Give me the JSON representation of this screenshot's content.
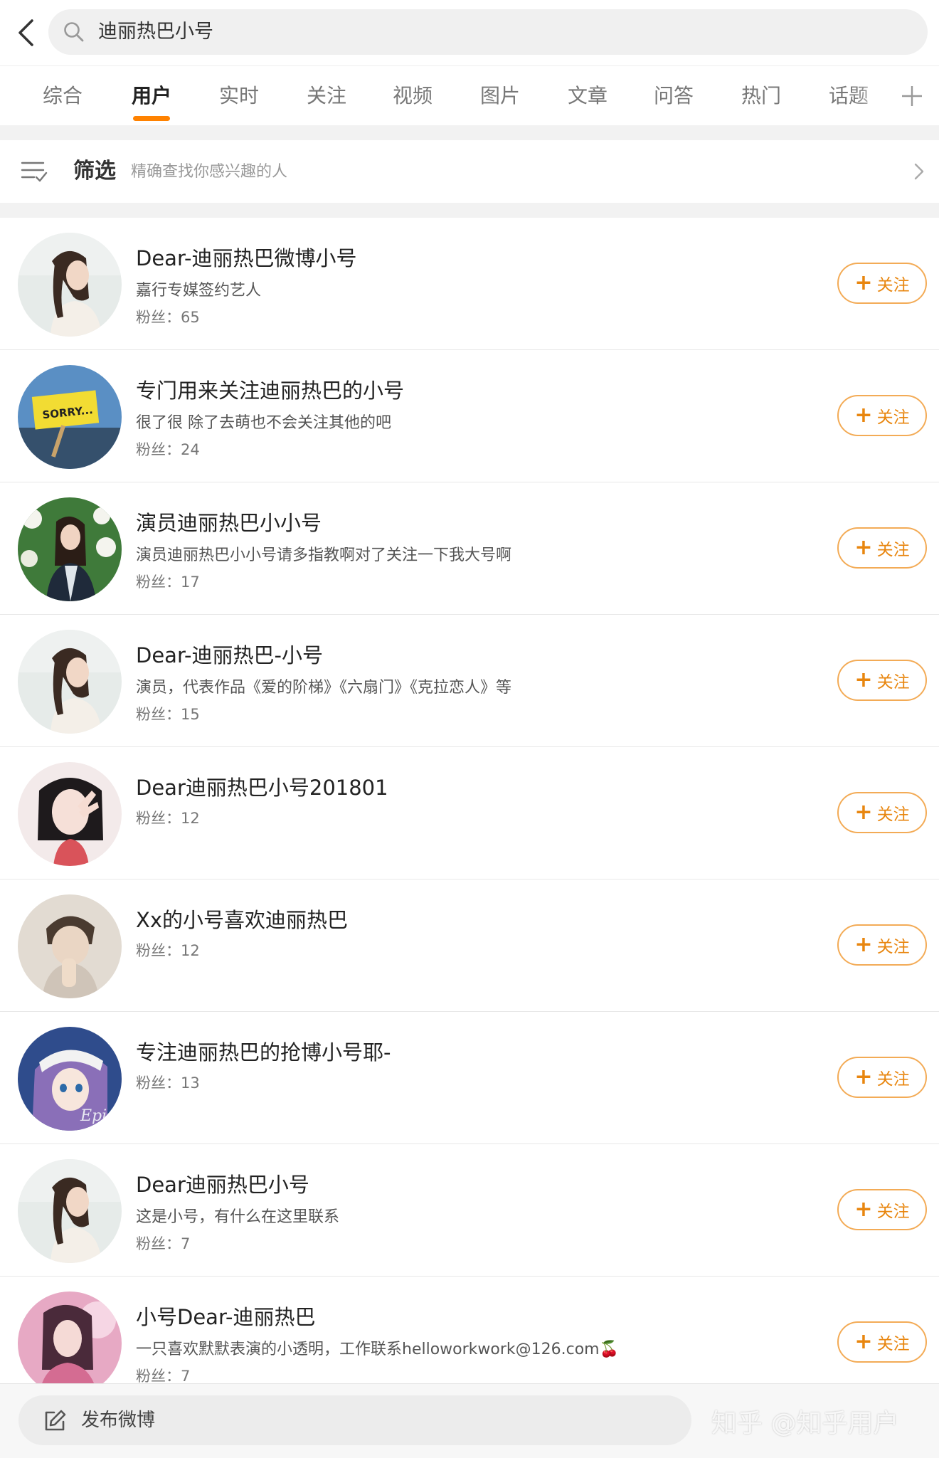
{
  "search": {
    "query": "迪丽热巴小号"
  },
  "tabs": [
    {
      "label": "综合"
    },
    {
      "label": "用户"
    },
    {
      "label": "实时"
    },
    {
      "label": "关注"
    },
    {
      "label": "视频"
    },
    {
      "label": "图片"
    },
    {
      "label": "文章"
    },
    {
      "label": "问答"
    },
    {
      "label": "热门"
    },
    {
      "label": "话题"
    }
  ],
  "active_tab": "用户",
  "filter": {
    "title": "筛选",
    "subtitle": "精确查找你感兴趣的人"
  },
  "follow_label": "关注",
  "users": [
    {
      "name": "Dear-迪丽热巴微博小号",
      "desc": "嘉行专媒签约艺人",
      "fans": "粉丝：65"
    },
    {
      "name": "专门用来关注迪丽热巴的小号",
      "desc": "很了很 除了去萌也不会关注其他的吧",
      "fans": "粉丝：24"
    },
    {
      "name": "演员迪丽热巴小小号",
      "desc": "演员迪丽热巴小小号请多指教啊对了关注一下我大号啊",
      "fans": "粉丝：17"
    },
    {
      "name": "Dear-迪丽热巴-小号",
      "desc": "演员，代表作品《爱的阶梯》《六扇门》《克拉恋人》等",
      "fans": "粉丝：15"
    },
    {
      "name": "Dear迪丽热巴小号201801",
      "desc": "",
      "fans": "粉丝：12"
    },
    {
      "name": "Xx的小号喜欢迪丽热巴",
      "desc": "",
      "fans": "粉丝：12"
    },
    {
      "name": "专注迪丽热巴的抢博小号耶-",
      "desc": "",
      "fans": "粉丝：13"
    },
    {
      "name": "Dear迪丽热巴小号",
      "desc": "这是小号，有什么在这里联系",
      "fans": "粉丝：7"
    },
    {
      "name": "小号Dear-迪丽热巴",
      "desc": "一只喜欢默默表演的小透明，工作联系helloworkwork@126.com🍒",
      "fans": "粉丝：7"
    }
  ],
  "bottom": {
    "compose": "发布微博",
    "watermark": "知乎 @知乎用户"
  },
  "colors": {
    "accent": "#ff8200",
    "follow_border": "#f3ab56",
    "follow_text": "#e8860f",
    "separator": "#f2f2f2"
  }
}
